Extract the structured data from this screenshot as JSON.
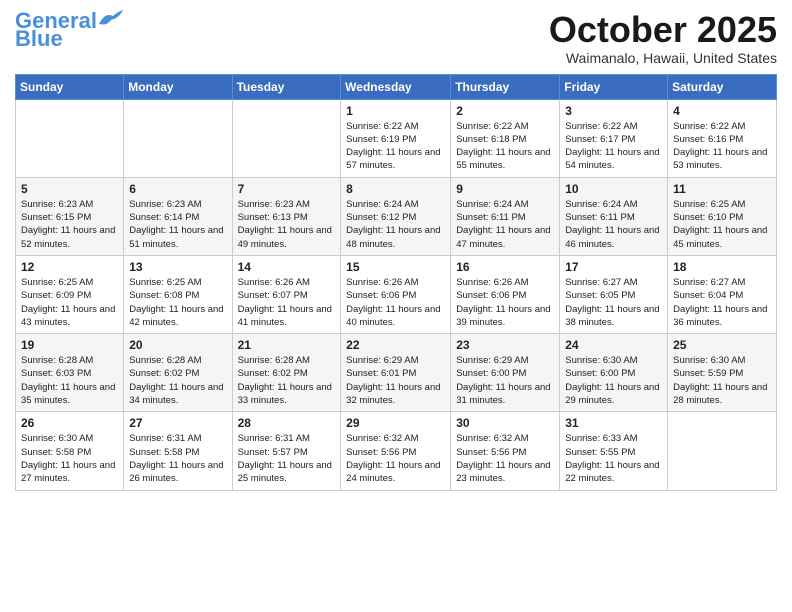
{
  "header": {
    "logo_line1": "General",
    "logo_line2": "Blue",
    "title": "October 2025",
    "location": "Waimanalo, Hawaii, United States"
  },
  "weekdays": [
    "Sunday",
    "Monday",
    "Tuesday",
    "Wednesday",
    "Thursday",
    "Friday",
    "Saturday"
  ],
  "weeks": [
    [
      {
        "day": "",
        "sunrise": "",
        "sunset": "",
        "daylight": ""
      },
      {
        "day": "",
        "sunrise": "",
        "sunset": "",
        "daylight": ""
      },
      {
        "day": "",
        "sunrise": "",
        "sunset": "",
        "daylight": ""
      },
      {
        "day": "1",
        "sunrise": "Sunrise: 6:22 AM",
        "sunset": "Sunset: 6:19 PM",
        "daylight": "Daylight: 11 hours and 57 minutes."
      },
      {
        "day": "2",
        "sunrise": "Sunrise: 6:22 AM",
        "sunset": "Sunset: 6:18 PM",
        "daylight": "Daylight: 11 hours and 55 minutes."
      },
      {
        "day": "3",
        "sunrise": "Sunrise: 6:22 AM",
        "sunset": "Sunset: 6:17 PM",
        "daylight": "Daylight: 11 hours and 54 minutes."
      },
      {
        "day": "4",
        "sunrise": "Sunrise: 6:22 AM",
        "sunset": "Sunset: 6:16 PM",
        "daylight": "Daylight: 11 hours and 53 minutes."
      }
    ],
    [
      {
        "day": "5",
        "sunrise": "Sunrise: 6:23 AM",
        "sunset": "Sunset: 6:15 PM",
        "daylight": "Daylight: 11 hours and 52 minutes."
      },
      {
        "day": "6",
        "sunrise": "Sunrise: 6:23 AM",
        "sunset": "Sunset: 6:14 PM",
        "daylight": "Daylight: 11 hours and 51 minutes."
      },
      {
        "day": "7",
        "sunrise": "Sunrise: 6:23 AM",
        "sunset": "Sunset: 6:13 PM",
        "daylight": "Daylight: 11 hours and 49 minutes."
      },
      {
        "day": "8",
        "sunrise": "Sunrise: 6:24 AM",
        "sunset": "Sunset: 6:12 PM",
        "daylight": "Daylight: 11 hours and 48 minutes."
      },
      {
        "day": "9",
        "sunrise": "Sunrise: 6:24 AM",
        "sunset": "Sunset: 6:11 PM",
        "daylight": "Daylight: 11 hours and 47 minutes."
      },
      {
        "day": "10",
        "sunrise": "Sunrise: 6:24 AM",
        "sunset": "Sunset: 6:11 PM",
        "daylight": "Daylight: 11 hours and 46 minutes."
      },
      {
        "day": "11",
        "sunrise": "Sunrise: 6:25 AM",
        "sunset": "Sunset: 6:10 PM",
        "daylight": "Daylight: 11 hours and 45 minutes."
      }
    ],
    [
      {
        "day": "12",
        "sunrise": "Sunrise: 6:25 AM",
        "sunset": "Sunset: 6:09 PM",
        "daylight": "Daylight: 11 hours and 43 minutes."
      },
      {
        "day": "13",
        "sunrise": "Sunrise: 6:25 AM",
        "sunset": "Sunset: 6:08 PM",
        "daylight": "Daylight: 11 hours and 42 minutes."
      },
      {
        "day": "14",
        "sunrise": "Sunrise: 6:26 AM",
        "sunset": "Sunset: 6:07 PM",
        "daylight": "Daylight: 11 hours and 41 minutes."
      },
      {
        "day": "15",
        "sunrise": "Sunrise: 6:26 AM",
        "sunset": "Sunset: 6:06 PM",
        "daylight": "Daylight: 11 hours and 40 minutes."
      },
      {
        "day": "16",
        "sunrise": "Sunrise: 6:26 AM",
        "sunset": "Sunset: 6:06 PM",
        "daylight": "Daylight: 11 hours and 39 minutes."
      },
      {
        "day": "17",
        "sunrise": "Sunrise: 6:27 AM",
        "sunset": "Sunset: 6:05 PM",
        "daylight": "Daylight: 11 hours and 38 minutes."
      },
      {
        "day": "18",
        "sunrise": "Sunrise: 6:27 AM",
        "sunset": "Sunset: 6:04 PM",
        "daylight": "Daylight: 11 hours and 36 minutes."
      }
    ],
    [
      {
        "day": "19",
        "sunrise": "Sunrise: 6:28 AM",
        "sunset": "Sunset: 6:03 PM",
        "daylight": "Daylight: 11 hours and 35 minutes."
      },
      {
        "day": "20",
        "sunrise": "Sunrise: 6:28 AM",
        "sunset": "Sunset: 6:02 PM",
        "daylight": "Daylight: 11 hours and 34 minutes."
      },
      {
        "day": "21",
        "sunrise": "Sunrise: 6:28 AM",
        "sunset": "Sunset: 6:02 PM",
        "daylight": "Daylight: 11 hours and 33 minutes."
      },
      {
        "day": "22",
        "sunrise": "Sunrise: 6:29 AM",
        "sunset": "Sunset: 6:01 PM",
        "daylight": "Daylight: 11 hours and 32 minutes."
      },
      {
        "day": "23",
        "sunrise": "Sunrise: 6:29 AM",
        "sunset": "Sunset: 6:00 PM",
        "daylight": "Daylight: 11 hours and 31 minutes."
      },
      {
        "day": "24",
        "sunrise": "Sunrise: 6:30 AM",
        "sunset": "Sunset: 6:00 PM",
        "daylight": "Daylight: 11 hours and 29 minutes."
      },
      {
        "day": "25",
        "sunrise": "Sunrise: 6:30 AM",
        "sunset": "Sunset: 5:59 PM",
        "daylight": "Daylight: 11 hours and 28 minutes."
      }
    ],
    [
      {
        "day": "26",
        "sunrise": "Sunrise: 6:30 AM",
        "sunset": "Sunset: 5:58 PM",
        "daylight": "Daylight: 11 hours and 27 minutes."
      },
      {
        "day": "27",
        "sunrise": "Sunrise: 6:31 AM",
        "sunset": "Sunset: 5:58 PM",
        "daylight": "Daylight: 11 hours and 26 minutes."
      },
      {
        "day": "28",
        "sunrise": "Sunrise: 6:31 AM",
        "sunset": "Sunset: 5:57 PM",
        "daylight": "Daylight: 11 hours and 25 minutes."
      },
      {
        "day": "29",
        "sunrise": "Sunrise: 6:32 AM",
        "sunset": "Sunset: 5:56 PM",
        "daylight": "Daylight: 11 hours and 24 minutes."
      },
      {
        "day": "30",
        "sunrise": "Sunrise: 6:32 AM",
        "sunset": "Sunset: 5:56 PM",
        "daylight": "Daylight: 11 hours and 23 minutes."
      },
      {
        "day": "31",
        "sunrise": "Sunrise: 6:33 AM",
        "sunset": "Sunset: 5:55 PM",
        "daylight": "Daylight: 11 hours and 22 minutes."
      },
      {
        "day": "",
        "sunrise": "",
        "sunset": "",
        "daylight": ""
      }
    ]
  ]
}
